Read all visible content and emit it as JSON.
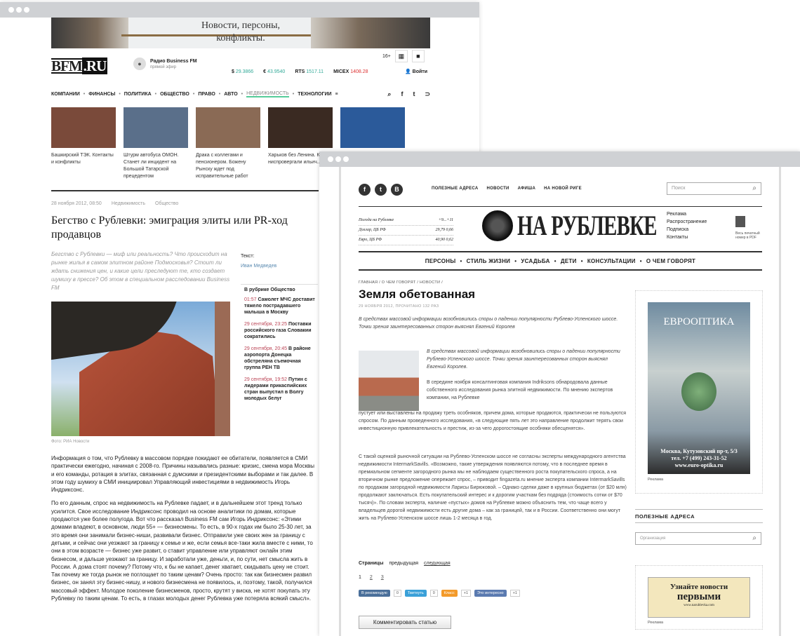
{
  "win1": {
    "banner_text": "Новости, персоны, конфликты.",
    "logo": {
      "a": "BFM",
      "b": ".RU"
    },
    "radio": {
      "name": "Радио Business FM",
      "sub": "прямой эфир"
    },
    "quotes": [
      {
        "label": "$",
        "value": "29.3866",
        "cls": "g"
      },
      {
        "label": "€",
        "value": "43.9540",
        "cls": "g"
      },
      {
        "label": "RTS",
        "value": "1517.11",
        "cls": "g"
      },
      {
        "label": "MICEX",
        "value": "1408.28",
        "cls": "r"
      }
    ],
    "age": "16+",
    "login": "Войти",
    "nav": [
      "КОМПАНИИ",
      "ФИНАНСЫ",
      "ПОЛИТИКА",
      "ОБЩЕСТВО",
      "ПРАВО",
      "АВТО",
      "НЕДВИЖИМОСТЬ",
      "ТЕХНОЛОГИИ"
    ],
    "news": [
      {
        "text": "Башкирский ТЭК. Контакты и конфликты",
        "color": "#7a4a3a"
      },
      {
        "text": "Штурм автобуса ОМОН. Станет ли инцидент на Большой Татарской прецедентом",
        "color": "#5a6f8a"
      },
      {
        "text": "Драка с коллегами и пенсионером. Божену Рынску ждет под исправительные работ",
        "color": "#8a6a55"
      },
      {
        "text": "Харьков без Ленина. Как ниспровергали ильич...",
        "color": "#3a2a22"
      },
      {
        "text": "",
        "color": "#2b5a9a"
      }
    ],
    "date": "28 ноября 2012, 08:50",
    "tags": [
      "Недвижимость",
      "Общество"
    ],
    "title": "Бегство с Рублевки: эмиграция элиты или PR-ход продавцов",
    "lead": "Бегство с Рублевки — миф или реальность? Что происходит на рынке жилья в самом элитном районе Подмосковья? Стоит ли ждать снижения цен, и какие цели преследуют те, кто создает шумиху в прессе? Об этом в специальном расследовании Business FM",
    "author_label": "Текст:",
    "author": "Иван Медведев",
    "rubric": {
      "head": "В рубрике Общество",
      "items": [
        {
          "time": "01:57",
          "text": "Самолет МЧС доставит тяжело пострадавшего малыша в Москву"
        },
        {
          "time": "29 сентября, 23:25",
          "text": "Поставки российского газа Словакии сократились"
        },
        {
          "time": "29 сентября, 20:45",
          "text": "В районе аэропорта Донецка обстреляна съемочная группа РЕН ТВ"
        },
        {
          "time": "29 сентября, 19:52",
          "text": "Путин с лидерами прикаспийских стран выпустил в Волгу молодых белуг"
        }
      ]
    },
    "photo_caption": "Фото: РИА Новости",
    "body": [
      "Информация о том, что Рублевку в массовом порядке покидают ее обитатели, появляется в СМИ практически ежегодно, начиная с 2008-го. Причины назывались разные: кризис, смена мэра Москвы и его команды, ротация в элитах, связанная с думскими и президентскими выборами и так далее. В этом году шумиху в СМИ инициировал Управляющий инвестициями в недвижимость Игорь Индриксонс.",
      "По его данным, спрос на недвижимость на Рублевке падает, и в дальнейшем этот тренд только усилится. Свое исследование Индриксонс проводил на основе аналитики по домам, которые продаются уже более полугода. Вот что рассказал Business FM сам Игорь Индриксонс: «Этими домами владеют, в основном, люди 55+ — бизнесмены. То есть, в 90-х годах им было 25-30 лет, за это время они занимали бизнес-ниши, развивали бизнес. Отправили уже своих жен за границу с детьми, и сейчас они уезжают за границу к семье и же, если семья все-таки жила вместе с ними, то они в этом возрасте — бизнес уже развит, о ставит управление или управляют онлайн этим бизнесом, и дальше уезжают за границу. И заработали уже, деньги, и, по сути, нет смысла жить в России. А дома стоят почему? Потому что, к бы не капает, денег хватает, скидывать цену не стоит. Так почему же тогда рынок не поглощает по таким ценам? Очень просто: так как бизнесмен развил бизнес, он занял эту бизнес-нишу, и нового бизнесмена не появилось, и, поэтому, такой, получился массовый эффект. Молодое поколение бизнесменов, просто, крутят у виска, не хотят покупать эту Рублевку по таким ценам. То есть, в глазах молодых денег Рублевка уже потеряла всякий смысл»."
    ]
  },
  "win2": {
    "social": [
      "f",
      "t",
      "В"
    ],
    "topnav": [
      "ПОЛЕЗНЫЕ АДРЕСА",
      "НОВОСТИ",
      "АФИША",
      "НА НОВОЙ РИГЕ"
    ],
    "search_placeholder": "Поиск",
    "rates": [
      {
        "k": "Погода на Рублевке",
        "v": "+9...+11"
      },
      {
        "k": "Доллар, ЦБ РФ",
        "v": "29,79  0,66"
      },
      {
        "k": "Евро, ЦБ РФ",
        "v": "40,90  0,62"
      }
    ],
    "logo": "НА РУБЛЕВКЕ",
    "right_links": [
      "Реклама",
      "Распространение",
      "Подписка",
      "Контакты"
    ],
    "pdf_text": "Весь печатный номер в PDF",
    "nav": [
      "ПЕРСОНЫ",
      "СТИЛЬ ЖИЗНИ",
      "УСАДЬБА",
      "ДЕТИ",
      "КОНСУЛЬТАЦИИ",
      "О ЧЕМ ГОВОРЯТ"
    ],
    "crumb": "ГЛАВНАЯ / О ЧЕМ ГОВОРЯТ / НОВОСТИ /",
    "title": "Земля обетованная",
    "date": "29 НОЯБРЯ 2012, ПРОЧИТАНО 132 РАЗ",
    "lead": "В средствах массовой информации возобновились споры о падении популярности Рублево-Успенского шоссе. Точки зрения заинтересованных сторон выяснял Евгений Королев",
    "quote": "В средствах массовой информации возобновились споры о падении популярности Рублево-Успенского шоссе. Точки зрения заинтересованных сторон выяснял Евгений Королев.",
    "p1": "В середине ноября консалтинговая компания Indriksons обнародовала данные собственного исследования рынка элитной недвижимости. По мнению экспертов компании, на Рублевке",
    "p2": "пустует или выставлены на продажу треть особняков, причем дома, которые продаются, практически не пользуются спросом. По данным проведенного исследования, «в следующие пять лет это направление продолжит терять свои инвестиционную привлекательность и престиж, из-за чего дорогостоящие особняки обесценятся».",
    "p3": "С такой оценкой рыночной ситуации на Рублево-Успенском шоссе не согласны эксперты международного агентства недвижимости IntermarkSavills. «Возможно, такие утверждения появляются потому, что в последнее время в премиальном сегменте загородного рынка мы не наблюдаем существенного роста покупательского спроса, а на вторичном рынке предложение опережает спрос, – приводит fingazeta.ru мнение эксперта компании IntermarkSavills по продажам загородной недвижимости Ларисы Бирюковой. – Однако сделки даже в крупных бюджетах (от $20 млн) продолжают заключаться. Есть покупательский интерес и к дорогим участкам без подряда (стоимость сотки от $70 тысяч)». По словам эксперта, наличие «пустых» домов на Рублевке можно объяснить тем, что чаще всего у владельцев дорогой недвижимости есть другие дома – как за границей, так и в России. Соответственно они могут жить на Рублево-Успенском шоссе лишь 1-2 месяца в год.",
    "pager_label": "Страницы",
    "pager_prev": "предыдущая",
    "pager_next": "следующая",
    "pages": [
      "1",
      "2",
      "3"
    ],
    "shares": [
      {
        "label": "В рекомендую",
        "count": "0",
        "color": "#4a6f9a"
      },
      {
        "label": "Твитнуть",
        "count": "0",
        "color": "#3aa0d8"
      },
      {
        "label": "Класс",
        "count": "+1",
        "color": "#f39a2a"
      },
      {
        "label": "Это интересно",
        "count": "+1",
        "color": "#5a7ab0"
      }
    ],
    "comment_btn": "Комментировать статью",
    "ad1": {
      "brand": "ЕВРООПТИКА",
      "addr": "Москва, Кутузовский пр-т, 5/3",
      "phone": "тел. +7 (499) 243-31-52",
      "site": "www.euro-optika.ru"
    },
    "ad_label": "Реклама",
    "useful": "ПОЛЕЗНЫЕ АДРЕСА",
    "org_placeholder": "Организация",
    "ad2": {
      "a": "Узнайте новости",
      "b": "первыми",
      "c": "www.narublevka.com"
    }
  }
}
